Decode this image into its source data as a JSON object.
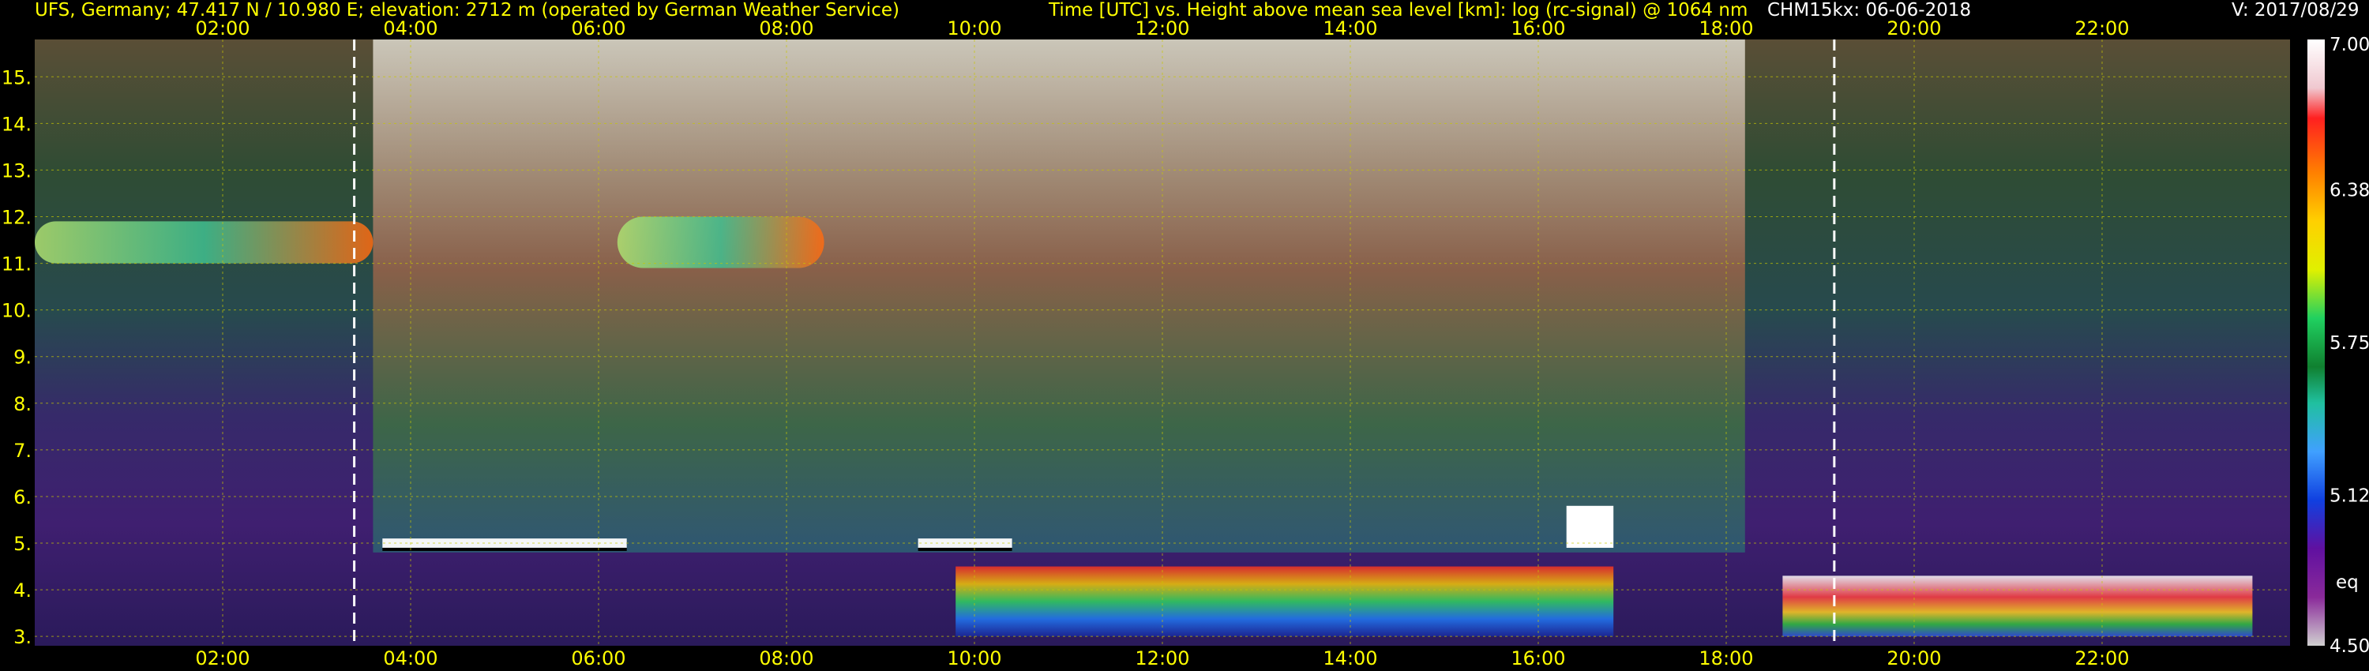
{
  "header": {
    "site": "UFS, Germany; 47.417 N / 10.980 E; elevation: 2712 m  (operated by German Weather Service)",
    "title": "Time [UTC] vs. Height above mean sea level [km]: log (rc-signal) @ 1064 nm",
    "instrument": "CHM15kx: 06-06-2018",
    "version": "V: 2017/08/29"
  },
  "colors": {
    "header_yellow": "#ffff00",
    "header_white": "#ffffff",
    "grid": "#c8c800"
  },
  "chart_data": {
    "type": "heatmap",
    "title": "Time [UTC] vs. Height above mean sea level [km]: log (rc-signal) @ 1064 nm",
    "x_ticks": [
      "02:00",
      "04:00",
      "06:00",
      "08:00",
      "10:00",
      "12:00",
      "14:00",
      "16:00",
      "18:00",
      "20:00",
      "22:00"
    ],
    "x_tick_hours": [
      2,
      4,
      6,
      8,
      10,
      12,
      14,
      16,
      18,
      20,
      22
    ],
    "xlim_hours": [
      0,
      24
    ],
    "y_ticks": [
      "3.",
      "4.",
      "5.",
      "6.",
      "7.",
      "8.",
      "9.",
      "10.",
      "11.",
      "12.",
      "13.",
      "14.",
      "15."
    ],
    "y_tick_values": [
      3,
      4,
      5,
      6,
      7,
      8,
      9,
      10,
      11,
      12,
      13,
      14,
      15
    ],
    "ylim_km": [
      2.8,
      15.8
    ],
    "colorbar": {
      "ticks": [
        "7.00",
        "6.38",
        "5.75",
        "5.12",
        "4.50"
      ],
      "tick_values": [
        7.0,
        6.38,
        5.75,
        5.12,
        4.5
      ],
      "range": [
        4.5,
        7.0
      ],
      "note": "eq"
    },
    "dashed_vertical_lines_hours": [
      3.4,
      19.15
    ],
    "features": [
      {
        "kind": "cirrus",
        "t_start": 0.0,
        "t_end": 3.6,
        "h_bottom": 11.0,
        "h_top": 11.9
      },
      {
        "kind": "cirrus",
        "t_start": 6.2,
        "t_end": 8.4,
        "h_bottom": 10.9,
        "h_top": 12.0
      },
      {
        "kind": "cloud_top_layer",
        "t_start": 3.7,
        "t_end": 6.3,
        "h_bottom": 4.9,
        "h_top": 5.1
      },
      {
        "kind": "cloud_top_layer",
        "t_start": 9.4,
        "t_end": 10.4,
        "h_bottom": 4.9,
        "h_top": 5.1
      },
      {
        "kind": "convective_boundary_layer",
        "t_start": 9.8,
        "t_end": 16.8,
        "h_bottom": 3.0,
        "h_top": 4.5
      },
      {
        "kind": "convective_cloud",
        "t_start": 16.3,
        "t_end": 16.8,
        "h_bottom": 4.9,
        "h_top": 5.8
      },
      {
        "kind": "evening_layer",
        "t_start": 18.6,
        "t_end": 23.6,
        "h_bottom": 3.0,
        "h_top": 4.3
      }
    ]
  }
}
